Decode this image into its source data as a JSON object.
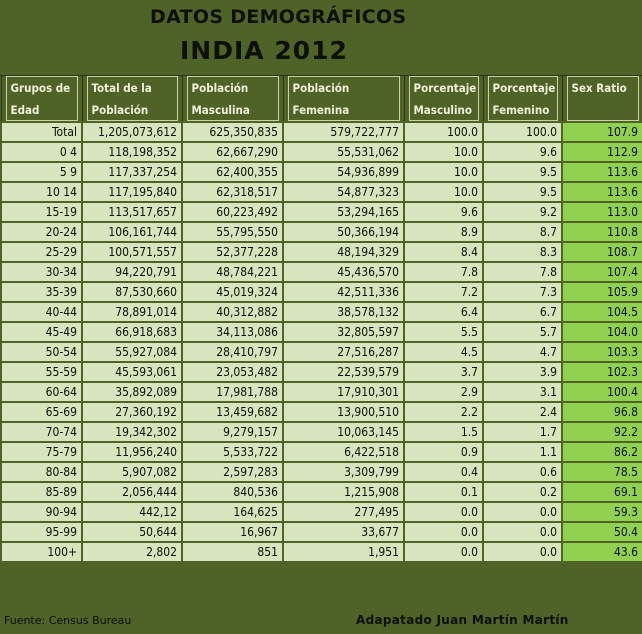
{
  "header": {
    "title": "DATOS DEMOGRÁFICOS",
    "subtitle": "INDIA 2012"
  },
  "columns": [
    "Grupos de Edad",
    "Total de la Población",
    "Población Masculina",
    "Población Femenina",
    "Porcentaje Masculino",
    "Porcentaje Femenino",
    "Sex Ratio"
  ],
  "rows": [
    [
      "Total",
      "1,205,073,612",
      "625,350,835",
      "579,722,777",
      "100.0",
      "100.0",
      "107.9"
    ],
    [
      "0 4",
      "118,198,352",
      "62,667,290",
      "55,531,062",
      "10.0",
      "9.6",
      "112.9"
    ],
    [
      "5 9",
      "117,337,254",
      "62,400,355",
      "54,936,899",
      "10.0",
      "9.5",
      "113.6"
    ],
    [
      "10 14",
      "117,195,840",
      "62,318,517",
      "54,877,323",
      "10.0",
      "9.5",
      "113.6"
    ],
    [
      "15-19",
      "113,517,657",
      "60,223,492",
      "53,294,165",
      "9.6",
      "9.2",
      "113.0"
    ],
    [
      "20-24",
      "106,161,744",
      "55,795,550",
      "50,366,194",
      "8.9",
      "8.7",
      "110.8"
    ],
    [
      "25-29",
      "100,571,557",
      "52,377,228",
      "48,194,329",
      "8.4",
      "8.3",
      "108.7"
    ],
    [
      "30-34",
      "94,220,791",
      "48,784,221",
      "45,436,570",
      "7.8",
      "7.8",
      "107.4"
    ],
    [
      "35-39",
      "87,530,660",
      "45,019,324",
      "42,511,336",
      "7.2",
      "7.3",
      "105.9"
    ],
    [
      "40-44",
      "78,891,014",
      "40,312,882",
      "38,578,132",
      "6.4",
      "6.7",
      "104.5"
    ],
    [
      "45-49",
      "66,918,683",
      "34,113,086",
      "32,805,597",
      "5.5",
      "5.7",
      "104.0"
    ],
    [
      "50-54",
      "55,927,084",
      "28,410,797",
      "27,516,287",
      "4.5",
      "4.7",
      "103.3"
    ],
    [
      "55-59",
      "45,593,061",
      "23,053,482",
      "22,539,579",
      "3.7",
      "3.9",
      "102.3"
    ],
    [
      "60-64",
      "35,892,089",
      "17,981,788",
      "17,910,301",
      "2.9",
      "3.1",
      "100.4"
    ],
    [
      "65-69",
      "27,360,192",
      "13,459,682",
      "13,900,510",
      "2.2",
      "2.4",
      "96.8"
    ],
    [
      "70-74",
      "19,342,302",
      "9,279,157",
      "10,063,145",
      "1.5",
      "1.7",
      "92.2"
    ],
    [
      "75-79",
      "11,956,240",
      "5,533,722",
      "6,422,518",
      "0.9",
      "1.1",
      "86.2"
    ],
    [
      "80-84",
      "5,907,082",
      "2,597,283",
      "3,309,799",
      "0.4",
      "0.6",
      "78.5"
    ],
    [
      "85-89",
      "2,056,444",
      "840,536",
      "1,215,908",
      "0.1",
      "0.2",
      "69.1"
    ],
    [
      "90-94",
      "442,12",
      "164,625",
      "277,495",
      "0.0",
      "0.0",
      "59.3"
    ],
    [
      "95-99",
      "50,644",
      "16,967",
      "33,677",
      "0.0",
      "0.0",
      "50.4"
    ],
    [
      "100+",
      "2,802",
      "851",
      "1,951",
      "0.0",
      "0.0",
      "43.6"
    ]
  ],
  "footer": {
    "source": "Fuente: Census Bureau",
    "credit": "Adapatado Juan Martín Martín"
  },
  "colors": {
    "frame": "#4f6228",
    "cell": "#d7e4bd",
    "sex_ratio": "#92d050"
  }
}
